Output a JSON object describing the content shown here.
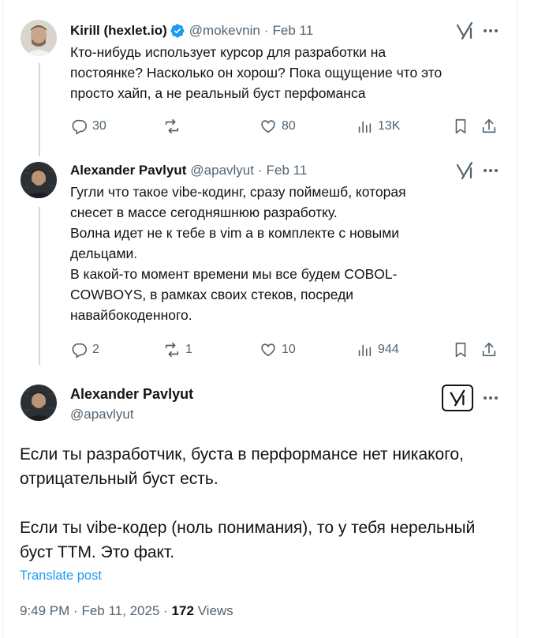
{
  "tweets": [
    {
      "name": "Kirill (hexlet.io)",
      "handle": "@mokevnin",
      "dot": "·",
      "date": "Feb 11",
      "text": "Кто-нибудь использует курсор для разработки на\nпостоянке? Насколько он хорош? Пока ощущение что это\nпросто хайп, а не реальный буст перфоманса",
      "replies": "30",
      "reposts": "",
      "likes": "80",
      "views": "13K"
    },
    {
      "name": "Alexander Pavlyut",
      "handle": "@apavlyut",
      "dot": "·",
      "date": "Feb 11",
      "text": "Гугли что такое vibe-кодинг, сразу поймешб, которая\nснесет в массе сегодняшнюю разработку.\nВолна идет не к тебе в vim а в комплекте с новыми\nдельцами.\nВ какой-то момент времени мы все будем COBOL-\nCOWBOYS, в рамках своих стеков, посреди\nнавайбокоденного.",
      "replies": "2",
      "reposts": "1",
      "likes": "10",
      "views": "944"
    }
  ],
  "main": {
    "name": "Alexander Pavlyut",
    "handle": "@apavlyut",
    "text": "Если ты разработчик, буста в перформансе нет никакого,\nотрицательный буст есть.\n\nЕсли ты vibe-кодер (ноль понимания), то у тебя нерельный\nбуст TTM. Это факт.",
    "translate": "Translate post",
    "time": "9:49 PM",
    "dot": "·",
    "date": "Feb 11, 2025",
    "views_count": "172",
    "views_label": "Views"
  },
  "icons": {
    "verified": "verified-badge-icon",
    "grok": "grok-icon",
    "more": "more-icon",
    "reply": "reply-icon",
    "repost": "repost-icon",
    "like": "like-icon",
    "views": "views-icon",
    "bookmark": "bookmark-icon",
    "share": "share-icon"
  },
  "colors": {
    "text": "#0f1419",
    "secondary": "#536471",
    "accent": "#1d9bf0",
    "thread_line": "#cfd9de"
  }
}
